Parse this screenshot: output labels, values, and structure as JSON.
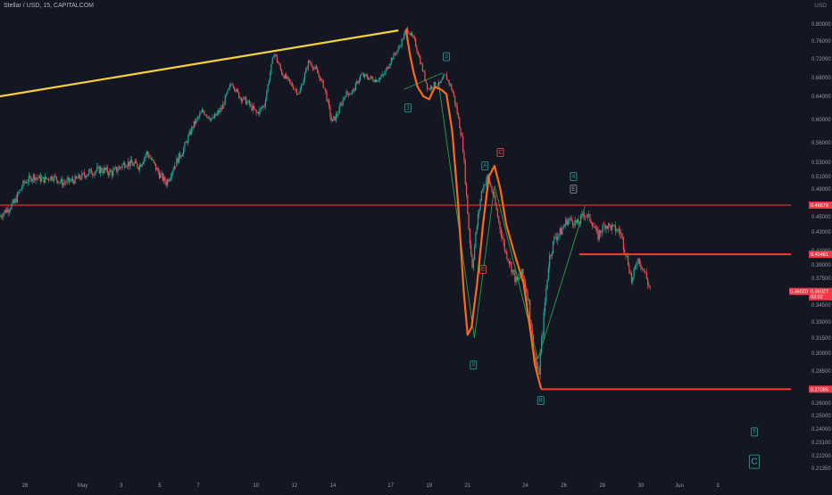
{
  "header": {
    "symbol": "Stellar / USD, 15, CAPITALCOM",
    "currency": "USD"
  },
  "colors": {
    "background": "#131722",
    "candle_up": "#26a69a",
    "candle_down": "#ef5350",
    "trendline": "#f5d142",
    "wave_path": "#ff6a1a",
    "wave_lines": "#2e9e4f",
    "level_line": "#ff3b30",
    "wave_box_green": "#26a69a",
    "wave_box_red": "#ef5350",
    "wave_box_grey": "#9598a1"
  },
  "chart_data": {
    "type": "candlestick",
    "title": "Stellar / USD, 15, CAPITALCOM",
    "ylabel": "USD",
    "ylim": [
      0.2,
      0.815
    ],
    "price_ticks": [
      "0.80000",
      "0.76000",
      "0.72000",
      "0.68000",
      "0.64000",
      "0.60000",
      "0.56000",
      "0.53000",
      "0.51000",
      "0.49000",
      "0.45000",
      "0.43000",
      "0.41000",
      "0.39000",
      "0.37500",
      "0.34500",
      "0.33000",
      "0.31500",
      "0.30000",
      "0.28500",
      "0.26000",
      "0.25000",
      "0.24000",
      "0.23100",
      "0.22200",
      "0.21350"
    ],
    "price_tick_values": [
      0.8,
      0.76,
      0.72,
      0.68,
      0.64,
      0.6,
      0.56,
      0.53,
      0.51,
      0.49,
      0.45,
      0.43,
      0.41,
      0.39,
      0.375,
      0.345,
      0.33,
      0.315,
      0.3,
      0.285,
      0.26,
      0.25,
      0.24,
      0.231,
      0.222,
      0.2135
    ],
    "date_ticks": [
      "28",
      "May",
      "3",
      "5",
      "7",
      "10",
      "12",
      "14",
      "17",
      "19",
      "21",
      "24",
      "26",
      "28",
      "30",
      "Jun",
      "3"
    ],
    "date_tick_days": [
      -3,
      0,
      2,
      4,
      6,
      9,
      11,
      13,
      16,
      18,
      20,
      23,
      25,
      27,
      29,
      31,
      33
    ],
    "x_range_days": [
      -4.3,
      36.8
    ],
    "series_path_price": [
      [
        -4.3,
        0.45
      ],
      [
        -3.5,
        0.47
      ],
      [
        -3,
        0.5
      ],
      [
        -2.5,
        0.51
      ],
      [
        -2,
        0.505
      ],
      [
        -1.5,
        0.51
      ],
      [
        -1,
        0.5
      ],
      [
        -0.3,
        0.505
      ],
      [
        0.3,
        0.515
      ],
      [
        1,
        0.52
      ],
      [
        1.6,
        0.515
      ],
      [
        2.3,
        0.53
      ],
      [
        3,
        0.525
      ],
      [
        3.4,
        0.545
      ],
      [
        4,
        0.515
      ],
      [
        4.4,
        0.5
      ],
      [
        4.8,
        0.525
      ],
      [
        5.3,
        0.55
      ],
      [
        5.8,
        0.59
      ],
      [
        6.3,
        0.615
      ],
      [
        6.8,
        0.6
      ],
      [
        7.3,
        0.62
      ],
      [
        7.8,
        0.67
      ],
      [
        8.2,
        0.64
      ],
      [
        8.6,
        0.63
      ],
      [
        9.1,
        0.61
      ],
      [
        9.5,
        0.625
      ],
      [
        10,
        0.735
      ],
      [
        10.4,
        0.69
      ],
      [
        10.8,
        0.67
      ],
      [
        11.3,
        0.645
      ],
      [
        11.8,
        0.715
      ],
      [
        12.2,
        0.695
      ],
      [
        12.6,
        0.66
      ],
      [
        13,
        0.595
      ],
      [
        13.3,
        0.61
      ],
      [
        13.7,
        0.645
      ],
      [
        14.1,
        0.65
      ],
      [
        14.5,
        0.685
      ],
      [
        14.9,
        0.68
      ],
      [
        15.3,
        0.675
      ],
      [
        15.7,
        0.685
      ],
      [
        16.1,
        0.72
      ],
      [
        16.5,
        0.745
      ],
      [
        16.9,
        0.79
      ],
      [
        17.3,
        0.76
      ],
      [
        17.7,
        0.7
      ],
      [
        18.0,
        0.655
      ],
      [
        18.3,
        0.665
      ],
      [
        18.6,
        0.665
      ],
      [
        18.9,
        0.685
      ],
      [
        19.2,
        0.66
      ],
      [
        19.5,
        0.615
      ],
      [
        19.8,
        0.56
      ],
      [
        20.1,
        0.44
      ],
      [
        20.3,
        0.39
      ],
      [
        20.5,
        0.43
      ],
      [
        20.8,
        0.49
      ],
      [
        21.1,
        0.51
      ],
      [
        21.4,
        0.48
      ],
      [
        21.7,
        0.44
      ],
      [
        22.0,
        0.41
      ],
      [
        22.3,
        0.39
      ],
      [
        22.6,
        0.37
      ],
      [
        22.9,
        0.38
      ],
      [
        23.2,
        0.355
      ],
      [
        23.5,
        0.3
      ],
      [
        23.75,
        0.28
      ],
      [
        24.0,
        0.33
      ],
      [
        24.3,
        0.4
      ],
      [
        24.6,
        0.425
      ],
      [
        24.9,
        0.43
      ],
      [
        25.2,
        0.445
      ],
      [
        25.5,
        0.445
      ],
      [
        25.8,
        0.44
      ],
      [
        26.1,
        0.455
      ],
      [
        26.5,
        0.445
      ],
      [
        26.8,
        0.425
      ],
      [
        27.2,
        0.44
      ],
      [
        27.6,
        0.435
      ],
      [
        28.0,
        0.43
      ],
      [
        28.3,
        0.405
      ],
      [
        28.6,
        0.37
      ],
      [
        28.9,
        0.4
      ],
      [
        29.2,
        0.385
      ],
      [
        29.5,
        0.365
      ]
    ],
    "last_price": 0.36027,
    "last_price_label": "0.36027",
    "bid_label": "0.36020",
    "countdown_label": "03:02",
    "price_levels": [
      {
        "name": "upper-resistance",
        "value": 0.46679,
        "label": "0.46679",
        "x_start_day": -4.3,
        "thickness": 1
      },
      {
        "name": "mid-resistance",
        "value": 0.40481,
        "label": "0.40481",
        "x_start_day": 25.8,
        "thickness": 2
      },
      {
        "name": "support",
        "value": 0.27085,
        "label": "0.27085",
        "x_start_day": 23.8,
        "thickness": 2
      }
    ],
    "trendline": {
      "from": [
        -4.3,
        0.64
      ],
      "to": [
        16.4,
        0.785
      ]
    },
    "wave_lines": [
      {
        "from": [
          16.7,
          0.655
        ],
        "to": [
          18.7,
          0.69
        ]
      },
      {
        "from": [
          18.5,
          0.665
        ],
        "to": [
          20.35,
          0.315
        ]
      },
      {
        "from": [
          20.35,
          0.315
        ],
        "to": [
          21.4,
          0.495
        ]
      },
      {
        "from": [
          21.4,
          0.495
        ],
        "to": [
          23.65,
          0.295
        ]
      },
      {
        "from": [
          23.65,
          0.295
        ],
        "to": [
          26.1,
          0.465
        ]
      }
    ],
    "orange_wave_path": [
      [
        16.8,
        0.785
      ],
      [
        17.0,
        0.73
      ],
      [
        17.2,
        0.69
      ],
      [
        17.4,
        0.66
      ],
      [
        17.7,
        0.64
      ],
      [
        18.0,
        0.635
      ],
      [
        18.3,
        0.66
      ],
      [
        18.6,
        0.655
      ],
      [
        18.9,
        0.645
      ],
      [
        19.2,
        0.58
      ],
      [
        19.5,
        0.47
      ],
      [
        19.8,
        0.36
      ],
      [
        20.0,
        0.318
      ],
      [
        20.2,
        0.325
      ],
      [
        20.5,
        0.37
      ],
      [
        20.8,
        0.44
      ],
      [
        21.1,
        0.51
      ],
      [
        21.4,
        0.525
      ],
      [
        21.7,
        0.49
      ],
      [
        22.0,
        0.44
      ],
      [
        22.5,
        0.4
      ],
      [
        22.9,
        0.37
      ],
      [
        23.2,
        0.33
      ],
      [
        23.5,
        0.29
      ],
      [
        23.8,
        0.272
      ]
    ],
    "wave_labels": [
      {
        "text": "1",
        "day": 16.9,
        "price": 0.62,
        "style": "green"
      },
      {
        "text": "2",
        "day": 18.9,
        "price": 0.725,
        "style": "green"
      },
      {
        "text": "A",
        "day": 20.9,
        "price": 0.525,
        "style": "green"
      },
      {
        "text": "C",
        "day": 21.7,
        "price": 0.545,
        "style": "red"
      },
      {
        "text": "E",
        "day": 20.8,
        "price": 0.385,
        "style": "red"
      },
      {
        "text": "3",
        "day": 20.3,
        "price": 0.29,
        "style": "green"
      },
      {
        "text": "4",
        "day": 25.5,
        "price": 0.51,
        "style": "green"
      },
      {
        "text": "E",
        "day": 25.5,
        "price": 0.49,
        "style": "grey"
      },
      {
        "text": "B",
        "day": 23.8,
        "price": 0.262,
        "style": "green"
      },
      {
        "text": "5",
        "day": 34.9,
        "price": 0.238,
        "style": "green"
      },
      {
        "text": "C",
        "day": 34.9,
        "price": 0.218,
        "style": "green-big"
      }
    ]
  }
}
